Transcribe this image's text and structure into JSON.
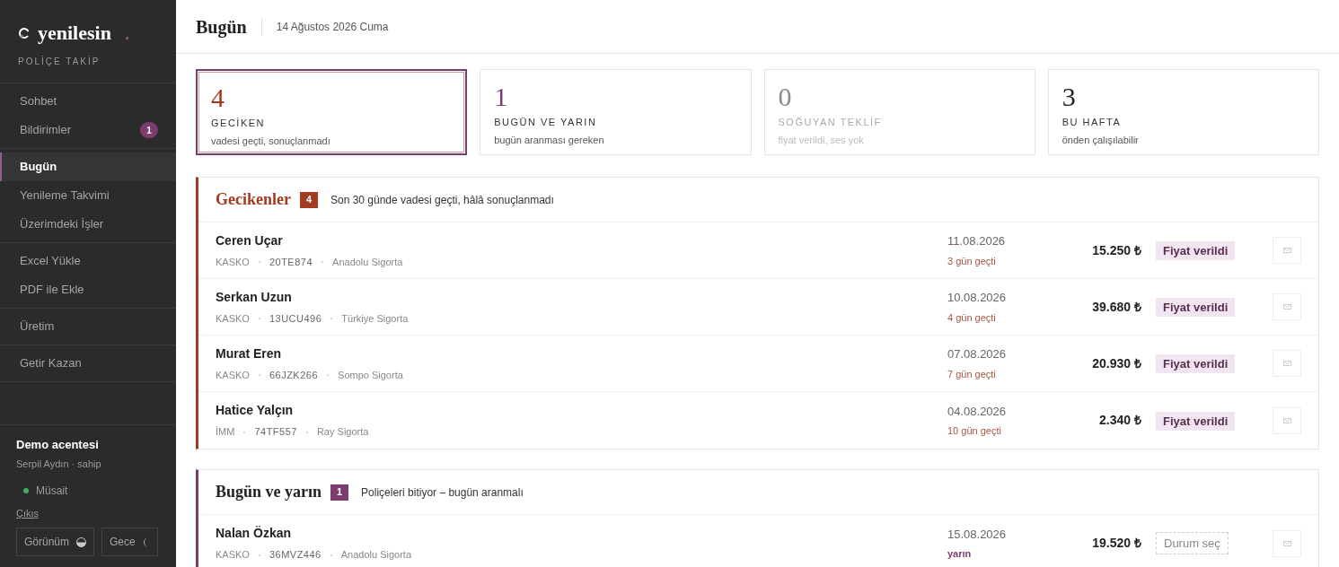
{
  "brand": {
    "name": "yenilesin",
    "tagline": "POLİÇE TAKİP"
  },
  "nav_groups": [
    {
      "items": [
        {
          "label": "Sohbet",
          "selected": false
        },
        {
          "label": "Bildirimler",
          "selected": false,
          "badge": "1"
        }
      ]
    },
    {
      "items": [
        {
          "label": "Bugün",
          "selected": true
        },
        {
          "label": "Yenileme Takvimi",
          "selected": false
        },
        {
          "label": "Üzerimdeki İşler",
          "selected": false
        }
      ]
    },
    {
      "items": [
        {
          "label": "Excel Yükle",
          "selected": false
        },
        {
          "label": "PDF ile Ekle",
          "selected": false
        }
      ]
    },
    {
      "items": [
        {
          "label": "Üretim",
          "selected": false
        }
      ]
    },
    {
      "items": [
        {
          "label": "Getir Kazan",
          "selected": false
        }
      ]
    }
  ],
  "account": {
    "agency": "Demo acentesi",
    "user": "Serpil Aydın · sahip",
    "status": "Müsait",
    "available": true,
    "logout": "Çıkış",
    "buttons": [
      {
        "label": "Görünüm",
        "kind": "appearance"
      },
      {
        "label": "Gece",
        "kind": "night"
      }
    ]
  },
  "header": {
    "title": "Bugün",
    "date": "14 Ağustos 2026 Cuma"
  },
  "stat_cards": [
    {
      "value": "4",
      "label": "GECİKEN",
      "hint": "vadesi geçti, sonuçlanmadı",
      "color": "#a33b22",
      "selected": true,
      "muted": false
    },
    {
      "value": "1",
      "label": "BUGÜN VE YARIN",
      "hint": "bugün aranması gereken",
      "color": "#7a3d6e",
      "selected": false,
      "muted": false
    },
    {
      "value": "0",
      "label": "SOĞUYAN TEKLİF",
      "hint": "fiyat verildi, ses yok",
      "color": "#8a8a8a",
      "selected": false,
      "muted": true
    },
    {
      "value": "3",
      "label": "BU HAFTA",
      "hint": "önden çalışılabilir",
      "color": "#222222",
      "selected": false,
      "muted": false
    }
  ],
  "sections": [
    {
      "title": "Gecikenler",
      "count": "4",
      "subtitle": "Son 30 günde vadesi geçti, hâlâ sonuçlanmadı",
      "color": "#a33b22",
      "rows": [
        {
          "name": "Ceren Uçar",
          "type": "KASKO",
          "plate": "20TE874",
          "insurer": "Anadolu Sigorta",
          "date": "11.08.2026",
          "due": "3 gün geçti",
          "amount": "15.250 ₺",
          "status": {
            "kind": "tag",
            "label": "Fiyat verildi"
          }
        },
        {
          "name": "Serkan Uzun",
          "type": "KASKO",
          "plate": "13UCU496",
          "insurer": "Türkiye Sigorta",
          "date": "10.08.2026",
          "due": "4 gün geçti",
          "amount": "39.680 ₺",
          "status": {
            "kind": "tag",
            "label": "Fiyat verildi"
          }
        },
        {
          "name": "Murat Eren",
          "type": "KASKO",
          "plate": "66JZK266",
          "insurer": "Sompo Sigorta",
          "date": "07.08.2026",
          "due": "7 gün geçti",
          "amount": "20.930 ₺",
          "status": {
            "kind": "tag",
            "label": "Fiyat verildi"
          }
        },
        {
          "name": "Hatice Yalçın",
          "type": "İMM",
          "plate": "74TF557",
          "insurer": "Ray Sigorta",
          "date": "04.08.2026",
          "due": "10 gün geçti",
          "amount": "2.340 ₺",
          "status": {
            "kind": "tag",
            "label": "Fiyat verildi"
          }
        }
      ]
    },
    {
      "title": "Bugün ve yarın",
      "count": "1",
      "subtitle": "Poliçeleri bitiyor – bugün aranmalı",
      "color": "#7a3d6e",
      "rows": [
        {
          "name": "Nalan Özkan",
          "type": "KASKO",
          "plate": "36MVZ446",
          "insurer": "Anadolu Sigorta",
          "date": "15.08.2026",
          "due": "yarın",
          "amount": "19.520 ₺",
          "status": {
            "kind": "select",
            "label": "Durum seç"
          }
        }
      ]
    }
  ]
}
